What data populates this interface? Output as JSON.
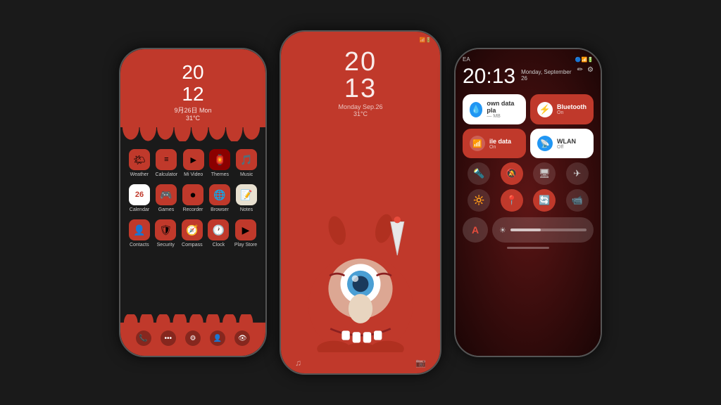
{
  "phone1": {
    "time": "20\n12",
    "date": "9月26日 Mon",
    "temp": "31°C",
    "apps_row1": [
      "Weather",
      "Calculator",
      "Mi Video",
      "Themes",
      "Music"
    ],
    "apps_row2": [
      "Calendar",
      "Games",
      "Recorder",
      "Browser",
      "Notes"
    ],
    "apps_row3": [
      "Contacts",
      "Security",
      "Compass",
      "Clock",
      "Play Store"
    ]
  },
  "phone2": {
    "time_top": "20",
    "time_bot": "13",
    "date": "Monday Sep.26",
    "temp": "31°C"
  },
  "phone3": {
    "ea": "EA",
    "time": "20:13",
    "date_day": "Monday, September",
    "date_num": "26",
    "tile1_label": "own data pla",
    "tile1_sub": "— MB",
    "tile2_label": "Bluetooth",
    "tile2_sub": "On",
    "tile3_label": "ile data",
    "tile3_sub": "On",
    "tile4_label": "WLAN",
    "tile4_sub": "Off"
  }
}
